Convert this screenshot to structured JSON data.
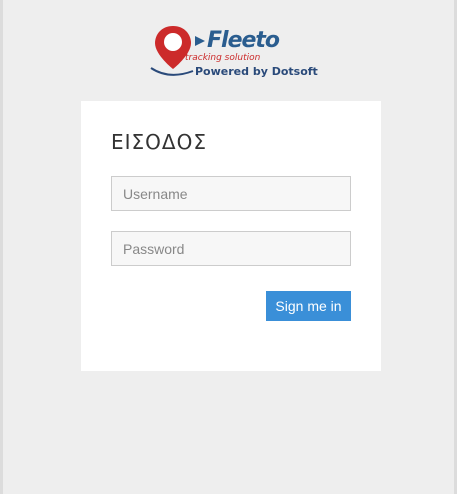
{
  "brand": {
    "name": "Fleeto",
    "tagline": "tracking solution",
    "powered_by": "Powered by Dotsoft"
  },
  "login": {
    "title": "ΕΙΣΟΔΟΣ",
    "username_placeholder": "Username",
    "username_value": "",
    "password_placeholder": "Password",
    "password_value": "",
    "submit_label": "Sign me in"
  },
  "icons": {
    "logo": "map-pin-icon",
    "arrow": "play-arrow-icon"
  },
  "colors": {
    "brand_blue": "#2a5d8f",
    "brand_red": "#cc2a2a",
    "button": "#3a8fd8",
    "background": "#eeeeee"
  }
}
